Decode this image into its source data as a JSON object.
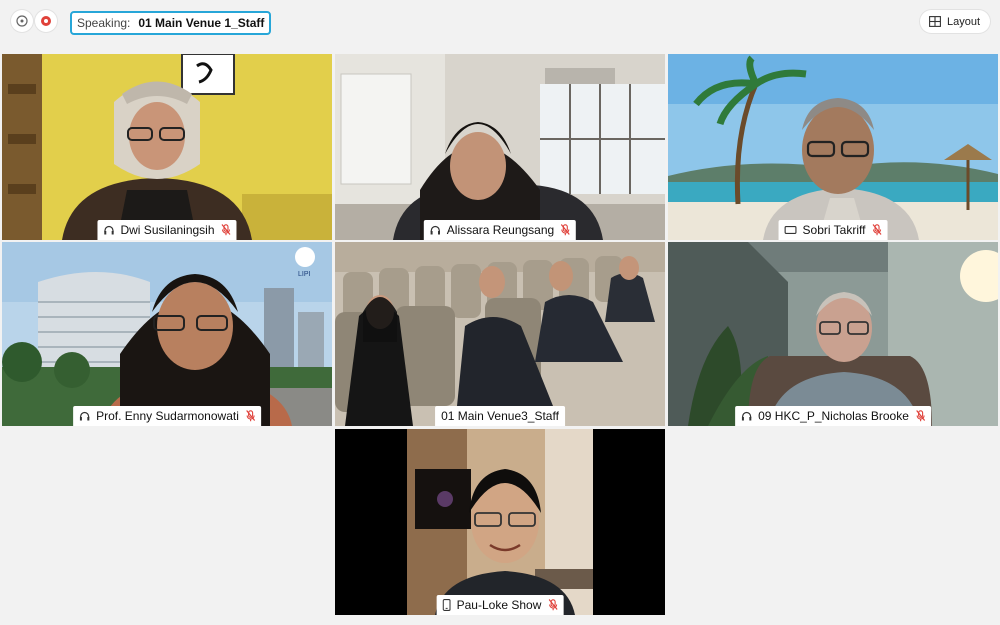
{
  "toolbar": {
    "speaking_label": "Speaking:",
    "speaking_name": "01 Main Venue 1_Staff",
    "layout_label": "Layout"
  },
  "participants": [
    {
      "name": "Dwi Susilaningsih",
      "device": "headset-icon",
      "muted": true
    },
    {
      "name": "Alissara Reungsang",
      "device": "headset-icon",
      "muted": true
    },
    {
      "name": "Sobri Takriff",
      "device": "video-icon",
      "muted": true
    },
    {
      "name": "Prof. Enny Sudarmonowati",
      "device": "headset-icon",
      "muted": true
    },
    {
      "name": "01 Main Venue3_Staff",
      "device": "none",
      "muted": false
    },
    {
      "name": "09 HKC_P_Nicholas Brooke",
      "device": "headset-icon",
      "muted": true
    },
    {
      "name": "Pau-Loke Show",
      "device": "phone-icon",
      "muted": true
    }
  ],
  "colors": {
    "accent": "#27a6d8",
    "muted_red": "#e0413a",
    "background": "#f2f2f2"
  }
}
